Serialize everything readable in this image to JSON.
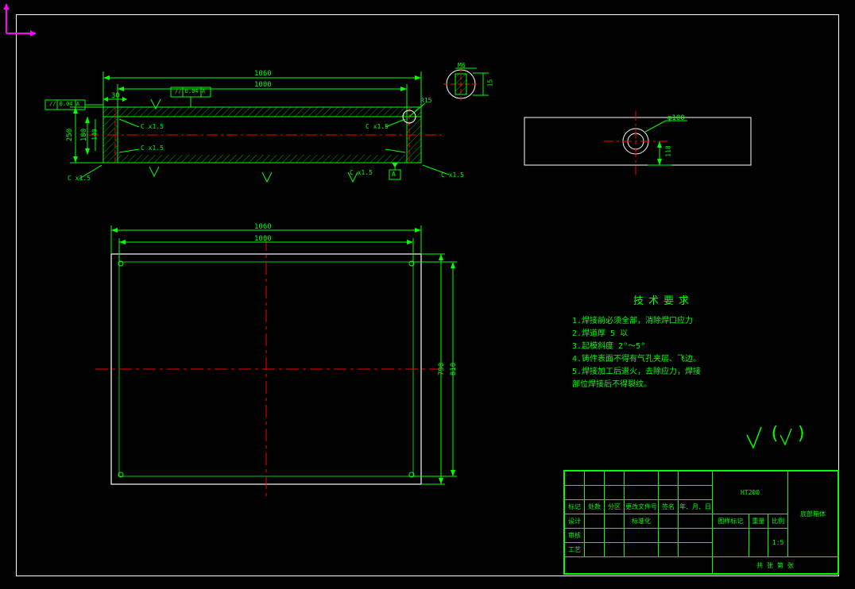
{
  "frame": {},
  "top_view": {
    "dims": {
      "overall_w": "1060",
      "inner_w": "1000",
      "left_offset": "30",
      "height_outer": "250",
      "height_inner_1": "180",
      "height_inner_2": "140",
      "corner_r": "R15"
    },
    "gd_t": {
      "parallel_left": "// 0.04 A",
      "parallel_right": "// 0.04 A",
      "datum": "A"
    },
    "chamfers": {
      "c1": "C x1.5",
      "c2": "C x1.5",
      "c3": "C x1.5",
      "c4": "C x1.5",
      "c5": "C x1.5",
      "c6": "C x1.5"
    },
    "detail_circle": {
      "label": "M6",
      "dim": "15"
    }
  },
  "front_view": {
    "dims": {
      "outer_w": "1060",
      "inner_w": "1000",
      "outer_h": "790",
      "inner_h": "810"
    }
  },
  "side_view": {
    "dims": {
      "dia": "φ100",
      "offset": "118"
    }
  },
  "tech": {
    "title": "技术要求",
    "l1": "1.焊接前必须全部，消除焊口应力",
    "l2": "2.焊道厚 5 以",
    "l3": "3.起模斜度 2°～5°",
    "l4": "4.铸件表面不得有气孔夹层、飞边。",
    "l5": "5.焊接加工后退火，去除应力，焊接",
    "l6": "  部位焊接后不得裂纹。"
  },
  "surface_all": "√  (√)",
  "titleblock": {
    "part_no": "HT200",
    "part_name": "底部箱体",
    "h1": "标记",
    "h2": "处数",
    "h3": "分区",
    "h4": "更改文件号",
    "h5": "签名",
    "h6": "年、月、日",
    "r1a": "设计",
    "r1c": "标准化",
    "r2a": "审核",
    "r3a": "工艺",
    "stage": "图样标记",
    "weight": "重量",
    "scale": "比例",
    "scale_v": "1:5",
    "sheet": "共  张  第  张"
  },
  "ucs": {
    "x": "X",
    "y": "Y"
  }
}
